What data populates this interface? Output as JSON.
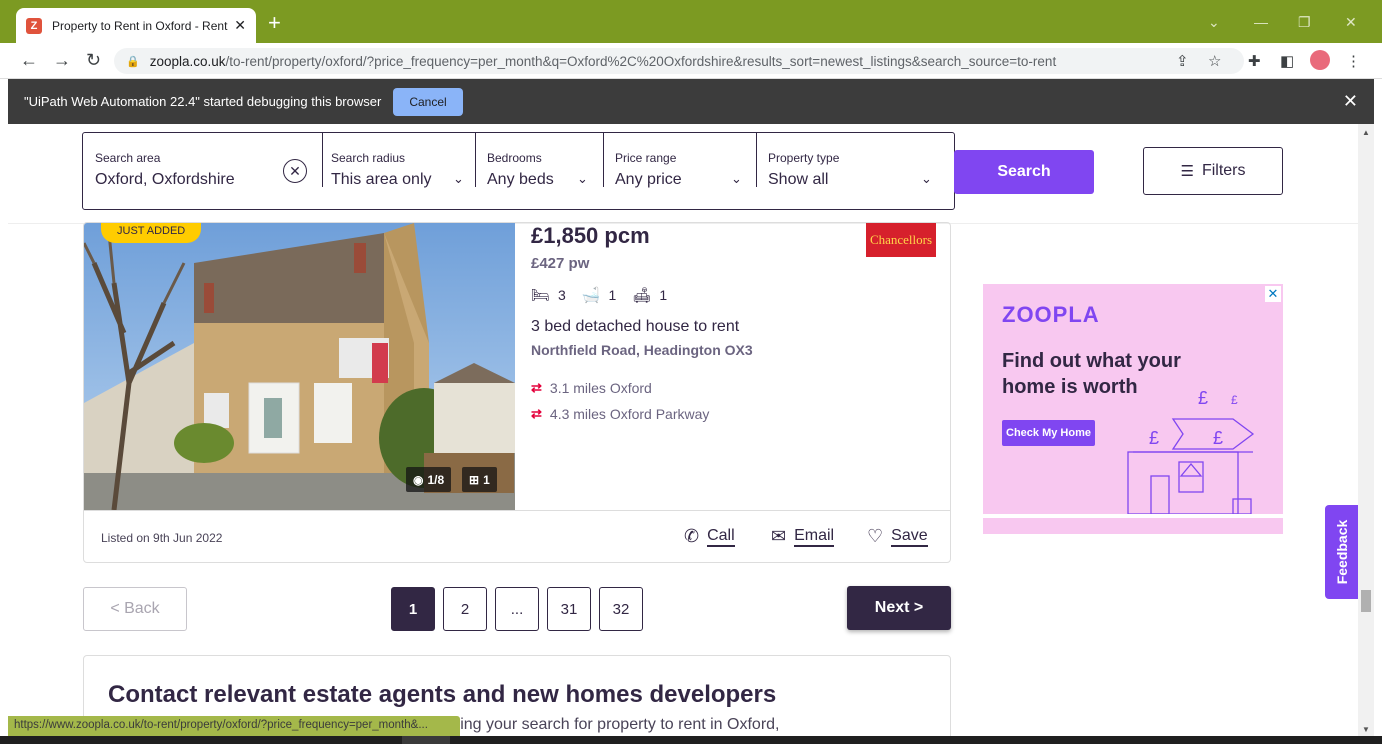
{
  "browser": {
    "tab_title": "Property to Rent in Oxford - Rent",
    "url_host": "zoopla.co.uk",
    "url_path": "/to-rent/property/oxford/?price_frequency=per_month&q=Oxford%2C%20Oxfordshire&results_sort=newest_listings&search_source=to-rent",
    "debug_message": "\"UiPath Web Automation 22.4\" started debugging this browser",
    "debug_cancel": "Cancel",
    "status_url": "https://www.zoopla.co.uk/to-rent/property/oxford/?price_frequency=per_month&..."
  },
  "search": {
    "area_label": "Search area",
    "area_value": "Oxford, Oxfordshire",
    "radius_label": "Search radius",
    "radius_value": "This area only",
    "bedrooms_label": "Bedrooms",
    "bedrooms_value": "Any beds",
    "price_label": "Price range",
    "price_value": "Any price",
    "type_label": "Property type",
    "type_value": "Show all",
    "search_button": "Search",
    "filters_button": "Filters"
  },
  "listing": {
    "badge": "JUST ADDED",
    "price_pcm": "£1,850 pcm",
    "price_pw": "£427 pw",
    "beds": "3",
    "baths": "1",
    "receptions": "1",
    "photos_count": "1/8",
    "floorplans_count": "1",
    "title": "3 bed detached house to rent",
    "address": "Northfield Road, Headington OX3",
    "stations": [
      {
        "text": "3.1 miles Oxford"
      },
      {
        "text": "4.3 miles Oxford Parkway"
      }
    ],
    "agent": "Chancellors",
    "listed_on": "Listed on 9th Jun 2022",
    "call": "Call",
    "email": "Email",
    "save": "Save"
  },
  "pagination": {
    "back": "< Back",
    "pages": [
      "1",
      "2",
      "...",
      "31",
      "32"
    ],
    "active_page": "1",
    "next": "Next >"
  },
  "contact": {
    "title": "Contact relevant estate agents and new homes developers",
    "text": "Send a message to agents and developers matching your search for property to rent in Oxford,"
  },
  "ad": {
    "logo": "ZOOPLA",
    "heading": "Find out what your home is worth",
    "button": "Check My Home"
  },
  "feedback": "Feedback",
  "colors": {
    "brand_purple": "#8046f1",
    "brand_dark": "#322744",
    "badge_yellow": "#ffcc00",
    "rail_red": "#e4003b"
  }
}
